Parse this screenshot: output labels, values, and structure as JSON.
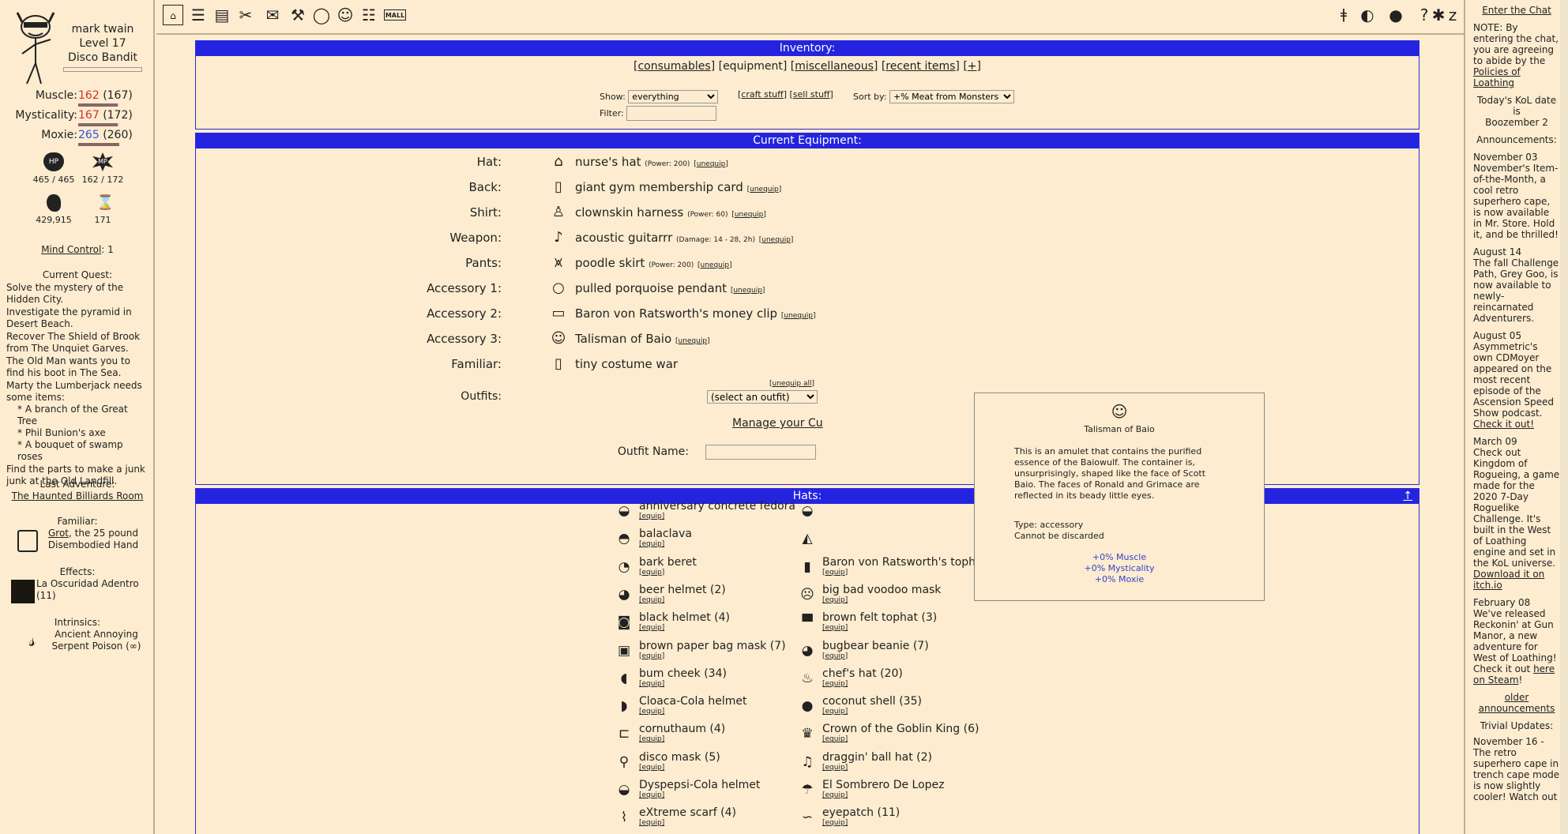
{
  "charpane": {
    "name": "mark twain",
    "level": "Level 17",
    "class": "Disco Bandit",
    "stats": [
      {
        "label": "Muscle:",
        "cur": "162",
        "base": "(167)",
        "pct": 0.97,
        "color": "red"
      },
      {
        "label": "Mysticality:",
        "cur": "167",
        "base": "(172)",
        "pct": 0.97,
        "color": "red"
      },
      {
        "label": "Moxie:",
        "cur": "265",
        "base": "(260)",
        "pct": 1,
        "color": "blu"
      }
    ],
    "hp": "465 / 465",
    "mp": "162 / 172",
    "meat": "429,915",
    "adventures": "171",
    "mind_control_label": "Mind Control",
    "mind_control_value": ": 1",
    "quests_title": "Current Quest:",
    "quests": [
      "Solve the mystery of the Hidden City.",
      "Investigate the pyramid in Desert Beach.",
      "Recover The Shield of Brook from The Unquiet Garves.",
      "The Old Man wants you to find his boot in The Sea.",
      "Marty the Lumberjack needs some items:"
    ],
    "quest_items": [
      "* A branch of the Great Tree",
      "* Phil Bunion's axe",
      "* A bouquet of swamp roses"
    ],
    "quest_last": "Find the parts to make a junk junk at the Old Landfill.",
    "last_adv_title": "Last Adventure:",
    "last_adv": "The Haunted Billiards Room",
    "familiar_title": "Familiar:",
    "familiar_name": "Grot",
    "familiar_desc": ", the 25 pound Disembodied Hand",
    "effects_title": "Effects:",
    "effect": "La Oscuridad Adentro (11)",
    "intrinsics_title": "Intrinsics:",
    "intrinsic": "Ancient Annoying Serpent Poison (∞)"
  },
  "topmenu": {
    "mall": "MALL"
  },
  "inventory": {
    "title": "Inventory:",
    "tabs": [
      "consumables",
      "equipment",
      "miscellaneous",
      "recent items",
      "+"
    ],
    "show_label": "Show:",
    "show_value": "everything",
    "craft": "craft stuff",
    "sell": "sell stuff",
    "sort_label": "Sort by:",
    "sort_value": "+% Meat from Monsters",
    "filter_label": "Filter:"
  },
  "equipment": {
    "title": "Current Equipment:",
    "rows": [
      {
        "label": "Hat:",
        "name": "nurse's hat",
        "extra": "(Power: 200)"
      },
      {
        "label": "Back:",
        "name": "giant gym membership card",
        "extra": ""
      },
      {
        "label": "Shirt:",
        "name": "clownskin harness",
        "extra": "(Power: 60)"
      },
      {
        "label": "Weapon:",
        "name": "acoustic guitarrr",
        "extra": "(Damage: 14 - 28, 2h)"
      },
      {
        "label": "Pants:",
        "name": "poodle skirt",
        "extra": "(Power: 200)"
      },
      {
        "label": "Accessory 1:",
        "name": "pulled porquoise pendant",
        "extra": ""
      },
      {
        "label": "Accessory 2:",
        "name": "Baron von Ratsworth's money clip",
        "extra": ""
      },
      {
        "label": "Accessory 3:",
        "name": "Talisman of Baio",
        "extra": ""
      },
      {
        "label": "Familiar:",
        "name": "tiny costume war",
        "extra": ""
      }
    ],
    "unequip": "unequip",
    "unequip_all": "unequip all",
    "outfits_label": "Outfits:",
    "outfits_value": "(select an outfit)",
    "manage": "Manage your Cu",
    "outfit_name_label": "Outfit Name:"
  },
  "hats": {
    "title": "Hats:",
    "equip": "equip",
    "up": "↑",
    "col1": [
      "anniversary concrete fedora",
      "balaclava",
      "bark beret",
      "beer helmet (2)",
      "black helmet (4)",
      "brown paper bag mask (7)",
      "bum cheek (34)",
      "Cloaca-Cola helmet",
      "cornuthaum (4)",
      "disco mask (5)",
      "Dyspepsi-Cola helmet",
      "eXtreme scarf (4)"
    ],
    "col2": [
      "",
      "",
      "Baron von Ratsworth's tophat",
      "big bad voodoo mask",
      "brown felt tophat (3)",
      "bugbear beanie (7)",
      "chef's hat (20)",
      "coconut shell (35)",
      "Crown of the Goblin King (6)",
      "draggin' ball hat (2)",
      "El Sombrero De Lopez",
      "eyepatch (11)"
    ]
  },
  "popup": {
    "name": "Talisman of Baio",
    "desc": "This is an amulet that contains the purified essence of the Baiowulf. The container is, unsurprisingly, shaped like the face of Scott Baio. The faces of Ronald and Grimace are reflected in its beady little eyes.",
    "type": "Type: accessory",
    "discard": "Cannot be discarded",
    "mods": [
      "+0% Muscle",
      "+0% Mysticality",
      "+0% Moxie"
    ]
  },
  "chat": {
    "enter": "Enter the Chat",
    "note_pre": "NOTE: By entering the chat, you are agreeing to abide by the ",
    "policies": "Policies of Loathing",
    "date_label": "Today's KoL date is",
    "date": "Boozember 2",
    "ann_title": "Announcements:",
    "ann": [
      {
        "d": "November 03",
        "t": "November's Item-of-the-Month, a cool retro superhero cape, is now available in Mr. Store. Hold it, and be thrilled!"
      },
      {
        "d": "August 14",
        "t": "The fall Challenge Path, Grey Goo, is now available to newly-reincarnated Adventurers."
      },
      {
        "d": "August 05",
        "t": "Asymmetric's own CDMoyer appeared on the most recent episode of the Ascension Speed Show podcast. ",
        "l": "Check it out!"
      },
      {
        "d": "March 09",
        "t": "Check out Kingdom of Rogueing, a game made for the 2020 7-Day Roguelike Challenge. It's built in the West of Loathing engine and set in the KoL universe. ",
        "l": "Download it on itch.io"
      },
      {
        "d": "February 08",
        "t": "We've released Reckonin' at Gun Manor, a new adventure for West of Loathing! Check it out ",
        "l": "here on Steam",
        "e": "!"
      }
    ],
    "older": "older announcements",
    "trivial": "Trivial Updates:",
    "trivial_date": "November 16 -",
    "trivial_text": "The retro superhero cape in trench cape mode is now slightly cooler! Watch out"
  }
}
